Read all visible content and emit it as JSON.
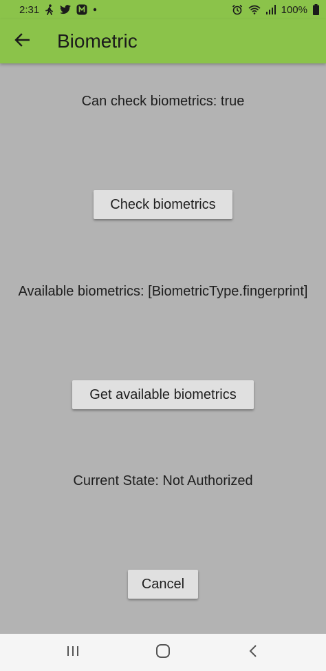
{
  "status_bar": {
    "time": "2:31",
    "battery": "100%",
    "icons": [
      "walking-icon",
      "twitter-icon",
      "app-notification-icon",
      "dot-icon",
      "alarm-icon",
      "wifi-icon",
      "signal-icon",
      "battery-icon"
    ]
  },
  "app_bar": {
    "title": "Biometric",
    "back_icon": "arrow-back-icon",
    "color": "#8bc34a"
  },
  "main": {
    "can_check_text": "Can check biometrics: true",
    "check_button_label": "Check biometrics",
    "available_text": "Available biometrics: [BiometricType.fingerprint]",
    "get_available_button_label": "Get available biometrics",
    "current_state_text": "Current State: Not Authorized",
    "cancel_button_label": "Cancel",
    "background": "#b3b3b3"
  },
  "nav_bar": {
    "items": [
      "recent-apps-icon",
      "home-icon",
      "back-icon"
    ]
  }
}
